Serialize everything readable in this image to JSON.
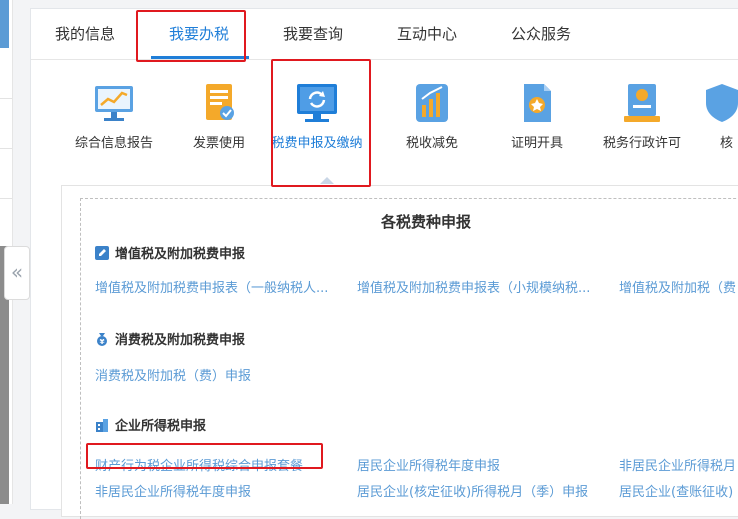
{
  "tabs": [
    {
      "label": "我的信息"
    },
    {
      "label": "我要办税"
    },
    {
      "label": "我要查询"
    },
    {
      "label": "互动中心"
    },
    {
      "label": "公众服务"
    }
  ],
  "service_icons": [
    {
      "label": "综合信息报告",
      "icon": "monitor-chart-icon"
    },
    {
      "label": "发票使用",
      "icon": "invoice-icon"
    },
    {
      "label": "税费申报及缴纳",
      "icon": "monitor-refresh-icon"
    },
    {
      "label": "税收减免",
      "icon": "bar-chart-icon"
    },
    {
      "label": "证明开具",
      "icon": "certificate-icon"
    },
    {
      "label": "税务行政许可",
      "icon": "license-icon"
    },
    {
      "label": "核",
      "icon": "partial-icon"
    }
  ],
  "content": {
    "title": "各税费种申报",
    "sections": [
      {
        "title": "增值税及附加税费申报",
        "icon": "edit-icon",
        "links": [
          "增值税及附加税费申报表（一般纳税人...",
          "增值税及附加税费申报表（小规模纳税...",
          "增值税及附加税（费"
        ]
      },
      {
        "title": "消费税及附加税费申报",
        "icon": "money-bag-icon",
        "links": [
          "消费税及附加税（费）申报"
        ]
      },
      {
        "title": "企业所得税申报",
        "icon": "building-icon",
        "links": [
          "财产行为税企业所得税综合申报套餐",
          "居民企业所得税年度申报",
          "非居民企业所得税月",
          "非居民企业所得税年度申报",
          "居民企业(核定征收)所得税月（季）申报",
          "居民企业(查账征收)"
        ]
      }
    ]
  },
  "colors": {
    "accent": "#1f7ed8",
    "link": "#5b9bd5",
    "highlight": "#e0191f"
  }
}
